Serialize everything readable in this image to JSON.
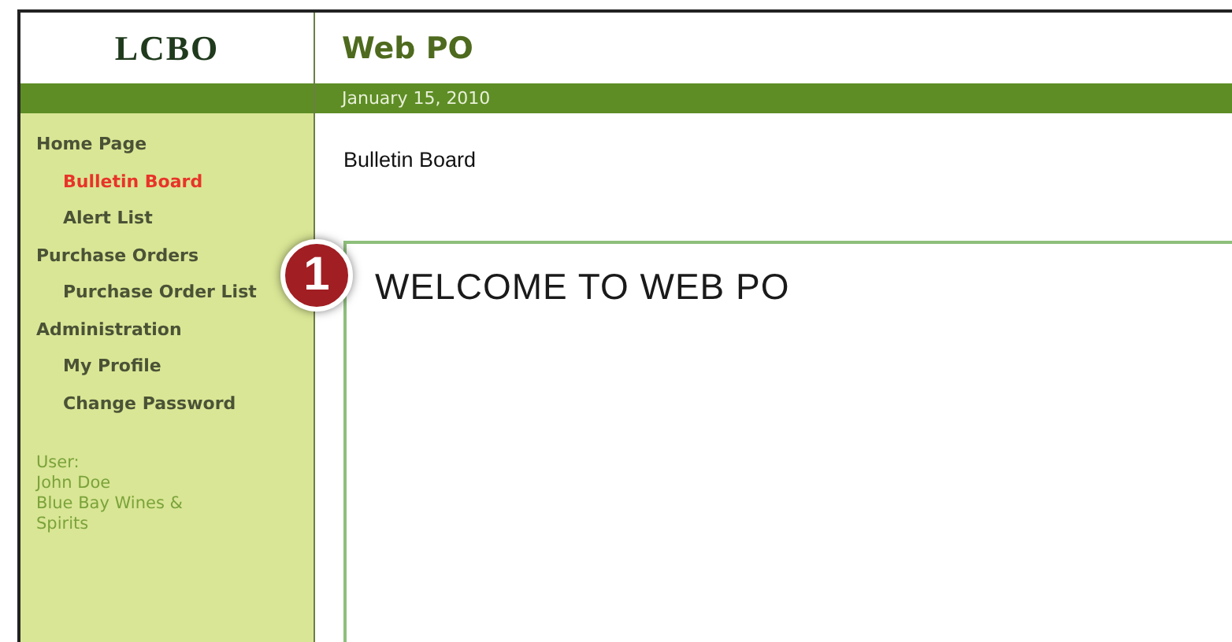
{
  "logo": {
    "text": "LCBO"
  },
  "app_title": "Web PO",
  "date": "January 15, 2010",
  "sidebar": {
    "items": [
      {
        "label": "Home Page",
        "selected": false,
        "children": [
          {
            "label": "Bulletin Board",
            "selected": true
          },
          {
            "label": "Alert List",
            "selected": false
          }
        ]
      },
      {
        "label": "Purchase Orders",
        "selected": false,
        "children": [
          {
            "label": "Purchase Order List",
            "selected": false
          }
        ]
      },
      {
        "label": "Administration",
        "selected": false,
        "children": [
          {
            "label": "My Profile",
            "selected": false
          },
          {
            "label": "Change Password",
            "selected": false
          }
        ]
      }
    ],
    "user": {
      "label": "User:",
      "name": "John Doe",
      "company": "Blue Bay Wines & Spirits"
    }
  },
  "page_heading": "Bulletin Board",
  "callout": {
    "number": "1",
    "text": "WELCOME TO WEB PO"
  }
}
